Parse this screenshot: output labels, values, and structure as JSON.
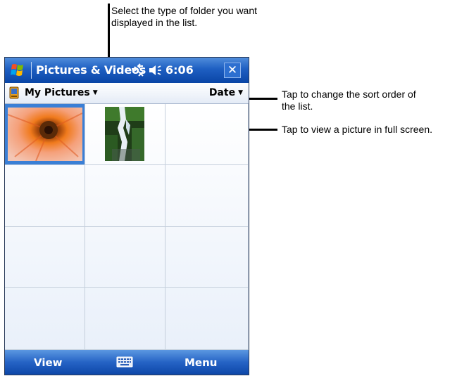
{
  "callouts": {
    "folder_type": "Select the type of folder you want displayed in the list.",
    "sort_order": "Tap to change the sort order of the list.",
    "full_screen": "Tap to view a picture in full screen."
  },
  "titlebar": {
    "start_icon": "windows-flag-icon",
    "title": "Pictures & Videos",
    "connectivity_icon": "connectivity-icon",
    "volume_icon": "volume-icon",
    "time": "6:06",
    "close_label": "✕"
  },
  "toolbar": {
    "folder_icon": "storage-card-icon",
    "folder": "My Pictures",
    "sort": "Date"
  },
  "thumbnails": [
    {
      "subject": "flower",
      "selected": true
    },
    {
      "subject": "waterfall",
      "selected": false
    }
  ],
  "menubar": {
    "left": "View",
    "keyboard_icon": "keyboard-icon",
    "right": "Menu"
  },
  "colors": {
    "titlebar": "#1e5fc2",
    "selection": "#3a7fd6",
    "grid_line": "#c5cfdc"
  }
}
